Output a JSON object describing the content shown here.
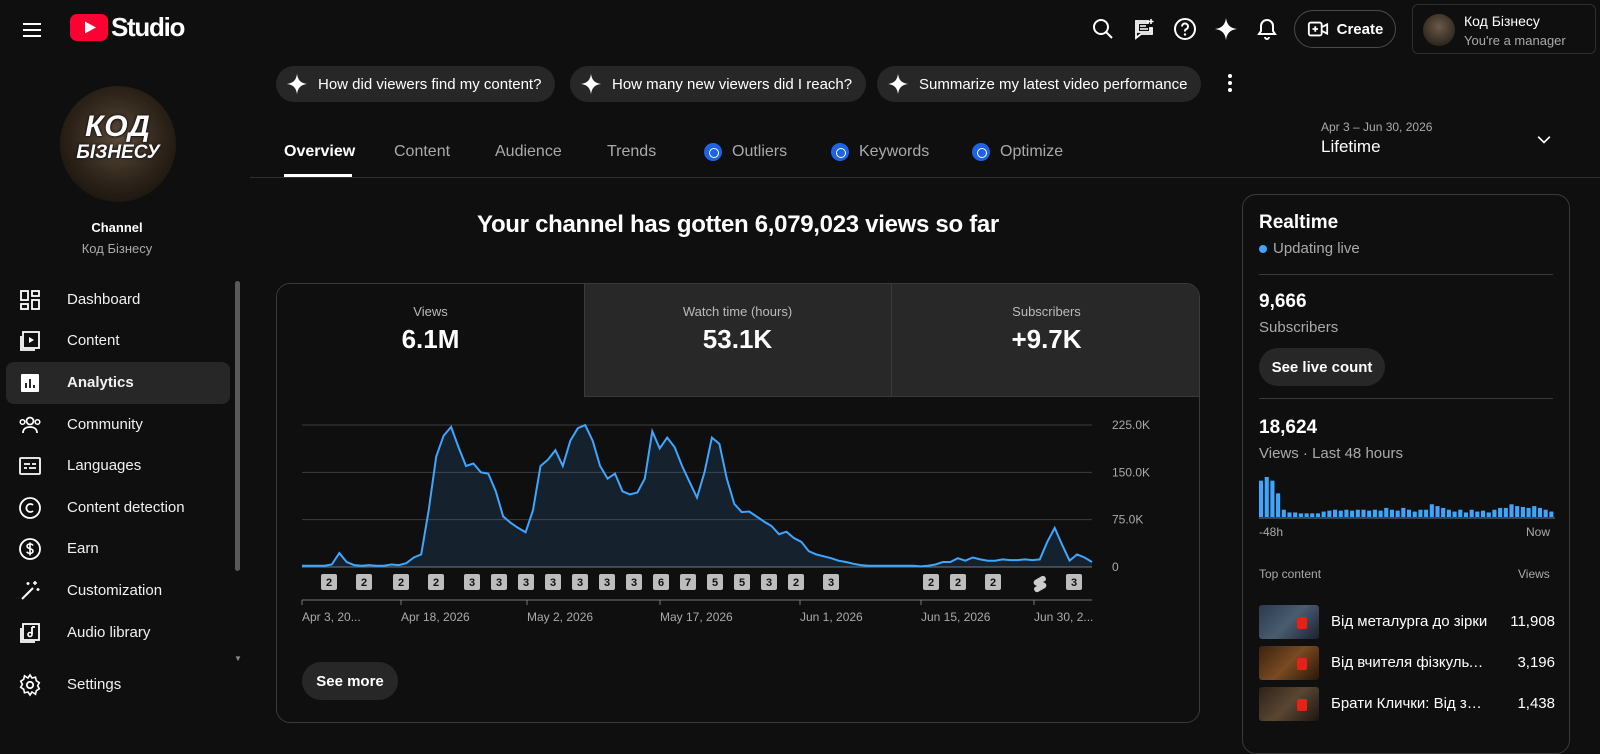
{
  "header": {
    "logo_text": "Studio",
    "create_label": "Create",
    "account": {
      "name": "Код Бізнесу",
      "role": "You're a manager"
    },
    "icons": [
      "search-icon",
      "feedback-icon",
      "help-icon",
      "sparkle-icon",
      "notifications-icon"
    ]
  },
  "chips": [
    {
      "label": "How did viewers find my content?"
    },
    {
      "label": "How many new viewers did I reach?"
    },
    {
      "label": "Summarize my latest video performance"
    }
  ],
  "sidebar": {
    "avatar_text_line1": "КОД",
    "avatar_text_line2": "БІЗНЕСУ",
    "channel_label": "Channel",
    "channel_name": "Код Бізнесу",
    "items": [
      {
        "label": "Dashboard",
        "icon": "dashboard-icon"
      },
      {
        "label": "Content",
        "icon": "content-icon"
      },
      {
        "label": "Analytics",
        "icon": "analytics-icon",
        "active": true
      },
      {
        "label": "Community",
        "icon": "community-icon"
      },
      {
        "label": "Languages",
        "icon": "languages-icon"
      },
      {
        "label": "Content detection",
        "icon": "copyright-icon"
      },
      {
        "label": "Earn",
        "icon": "earn-icon"
      },
      {
        "label": "Customization",
        "icon": "customization-icon"
      },
      {
        "label": "Audio library",
        "icon": "audio-library-icon"
      },
      {
        "label": "Settings",
        "icon": "settings-icon"
      }
    ]
  },
  "tabs": [
    {
      "label": "Overview",
      "active": true
    },
    {
      "label": "Content"
    },
    {
      "label": "Audience"
    },
    {
      "label": "Trends"
    },
    {
      "label": "Outliers",
      "badge": true
    },
    {
      "label": "Keywords",
      "badge": true
    },
    {
      "label": "Optimize",
      "badge": true
    }
  ],
  "date_range": {
    "range": "Apr 3 – Jun 30, 2026",
    "label": "Lifetime"
  },
  "headline": "Your channel has gotten 6,079,023 views so far",
  "metrics": [
    {
      "label": "Views",
      "value": "6.1M",
      "selected": true
    },
    {
      "label": "Watch time (hours)",
      "value": "53.1K"
    },
    {
      "label": "Subscribers",
      "value": "+9.7K"
    }
  ],
  "see_more_label": "See more",
  "chart_data": {
    "type": "area",
    "series": [
      {
        "values": [
          2000,
          2000,
          2000,
          2000,
          4000,
          22000,
          8000,
          3000,
          2000,
          3000,
          2000,
          2000,
          4000,
          3000,
          6000,
          15000,
          20000,
          90000,
          175000,
          208000,
          222000,
          190000,
          160000,
          164000,
          150000,
          148000,
          120000,
          80000,
          70000,
          62000,
          55000,
          90000,
          160000,
          170000,
          185000,
          160000,
          200000,
          220000,
          225000,
          200000,
          160000,
          140000,
          148000,
          120000,
          115000,
          118000,
          140000,
          215000,
          188000,
          205000,
          190000,
          160000,
          135000,
          110000,
          150000,
          205000,
          195000,
          140000,
          100000,
          87000,
          88000,
          80000,
          72000,
          65000,
          52000,
          56000,
          46000,
          40000,
          25000,
          20000,
          17000,
          14000,
          10000,
          8000,
          5000,
          3000,
          2000,
          2000,
          2000,
          2000,
          2000,
          2000,
          2000,
          1000,
          2000,
          4000,
          8000,
          8000,
          14000,
          10000,
          15000,
          12000,
          10000,
          10000,
          12000,
          11000,
          11000,
          12000,
          11000,
          12000,
          40000,
          62000,
          35000,
          10000,
          20000,
          15000,
          8000
        ]
      }
    ],
    "ylabels": [
      "225.0K",
      "150.0K",
      "75.0K",
      "0"
    ],
    "ylim": [
      0,
      225000
    ],
    "xlabels": [
      "Apr 3, 20...",
      "Apr 18, 2026",
      "May 2, 2026",
      "May 17, 2026",
      "Jun 1, 2026",
      "Jun 15, 2026",
      "Jun 30, 2..."
    ],
    "upload_markers": [
      "2",
      "2",
      "2",
      "2",
      "3",
      "3",
      "3",
      "3",
      "3",
      "3",
      "3",
      "6",
      "7",
      "5",
      "5",
      "3",
      "2",
      "3",
      "2",
      "2",
      "2",
      "shorts",
      "3"
    ],
    "grid": true
  },
  "realtime": {
    "title": "Realtime",
    "status": "Updating live",
    "subscribers_value": "9,666",
    "subscribers_label": "Subscribers",
    "live_count_label": "See live count",
    "views_value": "18,624",
    "views_label": "Views · Last 48 hours",
    "bars": [
      40,
      44,
      40,
      26,
      8,
      5,
      5,
      4,
      4,
      4,
      4,
      6,
      7,
      8,
      7,
      8,
      7,
      8,
      8,
      7,
      8,
      7,
      10,
      8,
      7,
      10,
      8,
      6,
      8,
      8,
      14,
      12,
      10,
      8,
      6,
      8,
      5,
      8,
      6,
      7,
      5,
      8,
      10,
      10,
      14,
      12,
      11,
      10,
      12,
      10,
      8,
      6
    ],
    "axis_start": "-48h",
    "axis_end": "Now",
    "top_content_label": "Top content",
    "views_col_label": "Views",
    "top_content": [
      {
        "title": "Від металурга до зірки",
        "views": "11,908",
        "thumb_color": "#3a4a5c"
      },
      {
        "title": "Від вчителя фізкультури",
        "views": "3,196",
        "thumb_color": "#5a3a20"
      },
      {
        "title": "Брати Клички: Від забутих",
        "views": "1,438",
        "thumb_color": "#4a3a2a"
      }
    ]
  }
}
